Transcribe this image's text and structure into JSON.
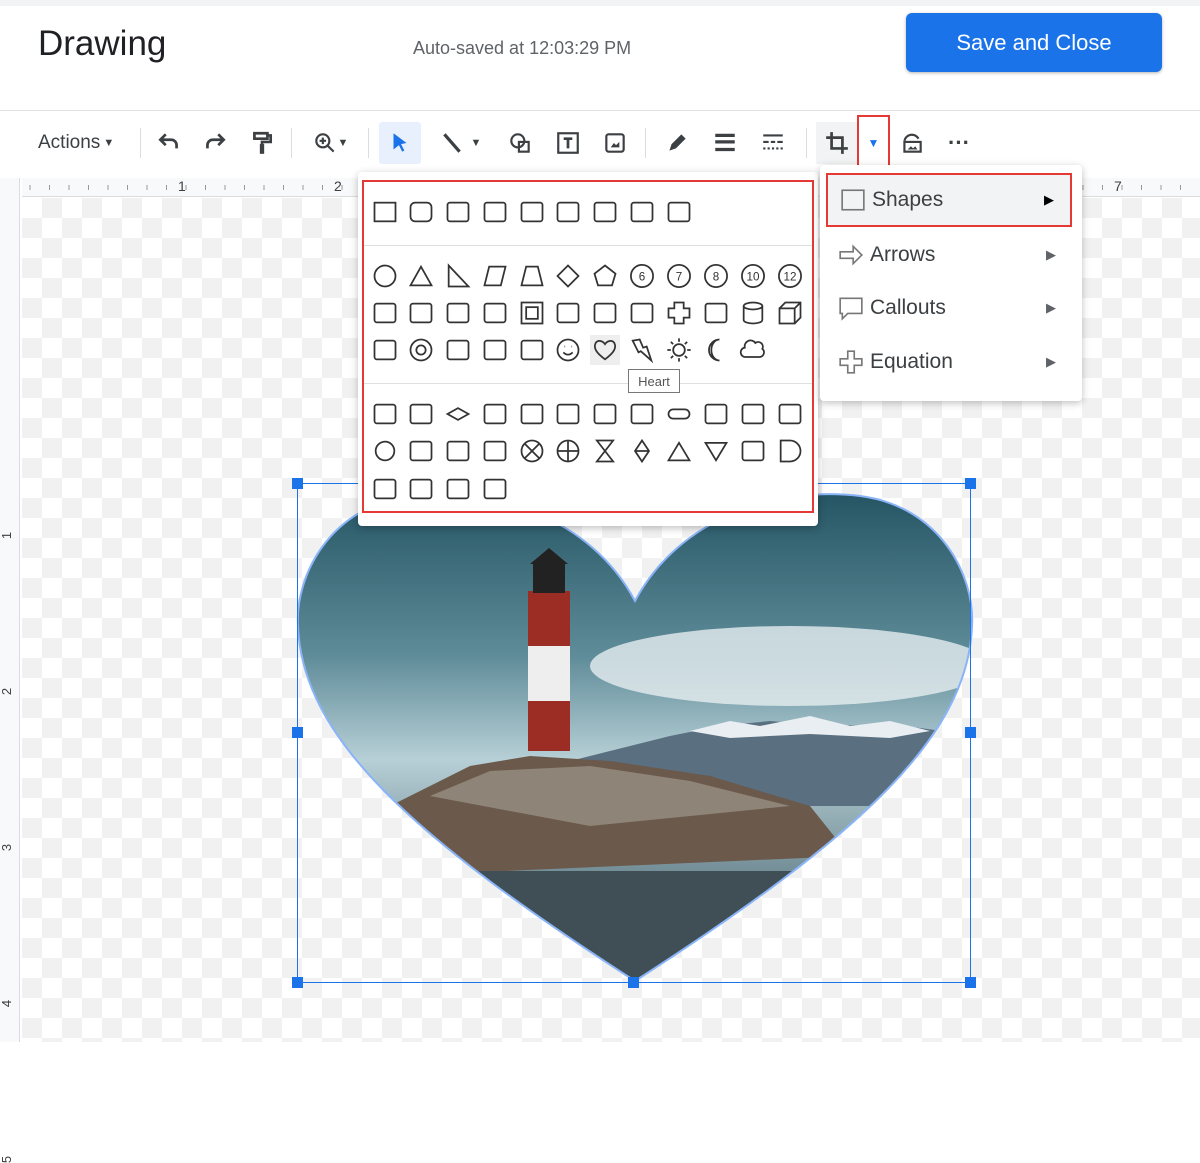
{
  "header": {
    "title": "Drawing",
    "autosave": "Auto-saved at 12:03:29 PM",
    "save_label": "Save and Close"
  },
  "toolbar": {
    "actions_label": "Actions",
    "icons": [
      "undo-icon",
      "redo-icon",
      "paint-format-icon",
      "zoom-icon",
      "select-icon",
      "line-icon",
      "shape-icon",
      "text-box-icon",
      "image-icon",
      "pen-icon",
      "line-weight-icon",
      "line-dash-icon",
      "crop-icon",
      "mask-dropdown-icon",
      "replace-image-icon",
      "more-icon"
    ]
  },
  "ruler": {
    "top_labels": [
      "1",
      "2",
      "7"
    ],
    "left_labels": [
      "1",
      "2",
      "3",
      "4",
      "5"
    ]
  },
  "mask_menu": {
    "items": [
      {
        "label": "Shapes",
        "icon": "square-icon"
      },
      {
        "label": "Arrows",
        "icon": "arrow-icon"
      },
      {
        "label": "Callouts",
        "icon": "callout-icon"
      },
      {
        "label": "Equation",
        "icon": "plus-icon"
      }
    ]
  },
  "shapes_panel": {
    "rows": [
      [
        "rectangle",
        "round-rect",
        "snip1",
        "snip2-same",
        "snip2-diag",
        "snip-round",
        "round1",
        "round2-same",
        "round2-diag"
      ],
      [
        "ellipse",
        "triangle",
        "right-triangle",
        "parallelogram",
        "trapezoid",
        "diamond",
        "pentagon",
        "hexagon-6",
        "heptagon-7",
        "octagon-8",
        "decagon-10",
        "dodecagon-12"
      ],
      [
        "pie",
        "arc",
        "teardrop",
        "chord",
        "frame",
        "half-frame",
        "l-shape",
        "diagonal-stripe",
        "plus",
        "plaque",
        "can",
        "cube"
      ],
      [
        "bevel",
        "donut",
        "no-symbol",
        "block-arc",
        "folded-corner",
        "smiley",
        "heart",
        "lightning",
        "sun",
        "moon",
        "cloud"
      ],
      [
        "fc-process",
        "fc-alternate",
        "fc-decision",
        "fc-data",
        "fc-predefined",
        "fc-internal",
        "fc-document",
        "fc-multidoc",
        "fc-terminator",
        "fc-preparation",
        "fc-manual-input",
        "fc-manual-op"
      ],
      [
        "fc-connector",
        "fc-offpage",
        "fc-card",
        "fc-tape",
        "fc-summing",
        "fc-or",
        "fc-collate",
        "fc-sort",
        "fc-extract",
        "fc-merge",
        "fc-stored-data",
        "fc-delay"
      ],
      [
        "fc-seq-access",
        "fc-magnetic-disk",
        "fc-direct-access",
        "fc-display"
      ]
    ],
    "hovered": "heart",
    "tooltip": "Heart"
  },
  "colors": {
    "accent": "#1a73e8",
    "highlight": "#e53935"
  }
}
